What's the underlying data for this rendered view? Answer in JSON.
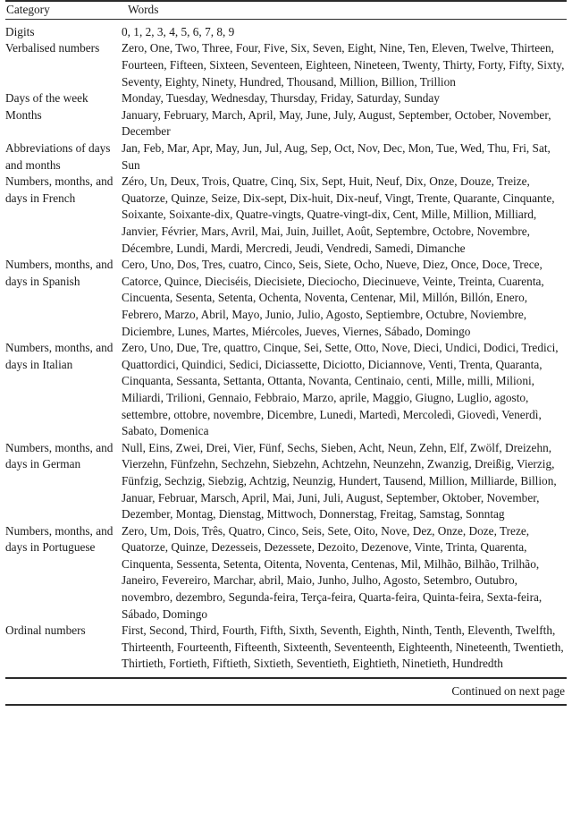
{
  "table": {
    "headers": {
      "category": "Category",
      "words": "Words"
    },
    "rows": [
      {
        "category": "Digits",
        "words": "0, 1, 2, 3, 4, 5, 6, 7, 8, 9"
      },
      {
        "category": "Verbalised numbers",
        "words": "Zero, One, Two, Three, Four, Five, Six, Seven, Eight, Nine, Ten, Eleven, Twelve, Thirteen, Fourteen, Fifteen, Sixteen, Seventeen, Eighteen, Nineteen, Twenty, Thirty, Forty, Fifty, Sixty, Seventy, Eighty, Ninety, Hundred, Thousand, Million, Billion, Trillion"
      },
      {
        "category": "Days of the week",
        "words": "Monday, Tuesday, Wednesday, Thursday, Friday, Saturday, Sunday"
      },
      {
        "category": "Months",
        "words": "January, February, March, April, May, June, July, August, September, October, November, December"
      },
      {
        "category": "Abbreviations of days and months",
        "words": "Jan, Feb, Mar, Apr, May, Jun, Jul, Aug, Sep, Oct, Nov, Dec, Mon, Tue, Wed, Thu, Fri, Sat, Sun"
      },
      {
        "category": "Numbers, months, and days in French",
        "words": "Zéro, Un, Deux, Trois, Quatre, Cinq, Six, Sept, Huit, Neuf, Dix, Onze, Douze, Treize, Quatorze, Quinze, Seize, Dix-sept, Dix-huit, Dix-neuf, Vingt, Trente, Quarante, Cinquante, Soixante, Soixante-dix, Quatre-vingts, Quatre-vingt-dix, Cent, Mille, Million, Milliard, Janvier, Février, Mars, Avril, Mai, Juin, Juillet, Août, Septembre, Octobre, Novembre, Décembre, Lundi, Mardi, Mercredi, Jeudi, Vendredi, Samedi, Dimanche"
      },
      {
        "category": "Numbers, months, and days in Spanish",
        "words": "Cero, Uno, Dos, Tres, cuatro, Cinco, Seis, Siete, Ocho, Nueve, Diez, Once, Doce, Trece, Catorce, Quince, Dieciséis, Diecisiete, Dieciocho, Diecinueve, Veinte, Treinta, Cuarenta, Cincuenta, Sesenta, Setenta, Ochenta, Noventa, Centenar, Mil, Millón, Billón, Enero, Febrero, Marzo, Abril, Mayo, Junio, Julio, Agosto, Septiembre, Octubre, Noviembre, Diciembre, Lunes, Martes, Miércoles, Jueves, Viernes, Sábado, Domingo"
      },
      {
        "category": "Numbers, months, and days in Italian",
        "words": "Zero, Uno, Due, Tre, quattro, Cinque, Sei, Sette, Otto, Nove, Dieci, Undici, Dodici, Tredici, Quattordici, Quindici, Sedici, Diciassette, Diciotto, Diciannove, Venti, Trenta, Quaranta, Cinquanta, Sessanta, Settanta, Ottanta, Novanta, Centinaio, centi, Mille, milli, Milioni, Miliardi, Trilioni, Gennaio, Febbraio, Marzo, aprile, Maggio, Giugno, Luglio, agosto, settembre, ottobre, novembre, Dicembre, Lunedi, Martedì, Mercoledì, Giovedì, Venerdì, Sabato, Domenica"
      },
      {
        "category": "Numbers, months, and days in German",
        "words": "Null, Eins, Zwei, Drei, Vier, Fünf, Sechs, Sieben, Acht, Neun, Zehn, Elf, Zwölf, Dreizehn, Vierzehn, Fünfzehn, Sechzehn, Siebzehn, Achtzehn, Neunzehn, Zwanzig, Dreißig, Vierzig, Fünfzig, Sechzig, Siebzig, Achtzig, Neunzig, Hundert, Tausend, Million, Milliarde, Billion, Januar, Februar, Marsch, April, Mai, Juni, Juli, August, September, Oktober, November, Dezember, Montag, Dienstag, Mittwoch, Donnerstag, Freitag, Samstag, Sonntag"
      },
      {
        "category": "Numbers, months, and days in Portuguese",
        "words": "Zero, Um, Dois, Três, Quatro, Cinco, Seis, Sete, Oito, Nove, Dez, Onze, Doze, Treze, Quatorze, Quinze, Dezesseis, Dezessete, Dezoito, Dezenove, Vinte, Trinta, Quarenta, Cinquenta, Sessenta, Setenta, Oitenta, Noventa, Centenas, Mil, Milhão, Bilhão, Trilhão, Janeiro, Fevereiro, Marchar, abril, Maio, Junho, Julho, Agosto, Setembro, Outubro, novembro, dezembro, Segunda-feira, Terça-feira, Quarta-feira, Quinta-feira, Sexta-feira, Sábado, Domingo"
      },
      {
        "category": "Ordinal numbers",
        "words": "First, Second, Third, Fourth, Fifth, Sixth, Seventh, Eighth, Ninth, Tenth, Eleventh, Twelfth, Thirteenth, Fourteenth, Fifteenth, Sixteenth, Seventeenth, Eighteenth, Nineteenth, Twentieth, Thirtieth, Fortieth, Fiftieth, Sixtieth, Seventieth, Eightieth, Ninetieth, Hundredth"
      }
    ]
  },
  "footer": {
    "continued_note": "Continued on next page"
  }
}
